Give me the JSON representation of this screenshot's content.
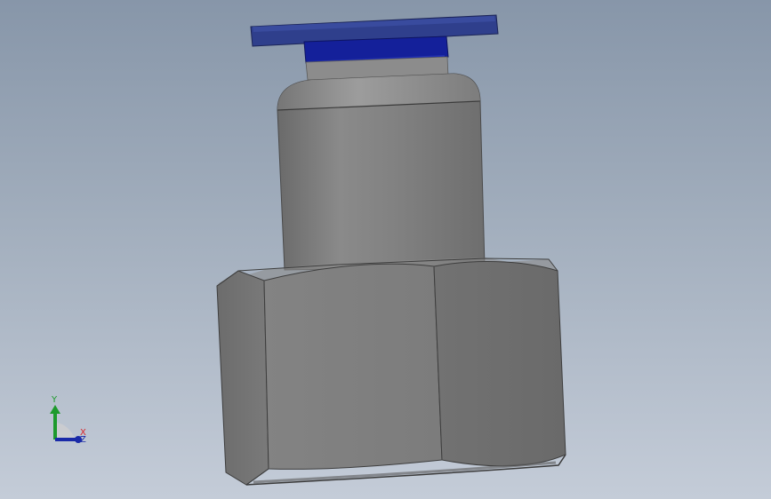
{
  "viewport": {
    "background_top": "#8796a9",
    "background_bottom": "#c4ccd8"
  },
  "model": {
    "cap_color": "#2f3f8c",
    "collet_color": "#14209a",
    "body_color": "#7a7a7a",
    "hex_color": "#6f6f6f"
  },
  "triad": {
    "y_label": "Y",
    "x_label": "X",
    "z_label": "Z",
    "y_color": "#1d9a2c",
    "x_color": "#d9252a",
    "z_color": "#1a2aa8"
  }
}
